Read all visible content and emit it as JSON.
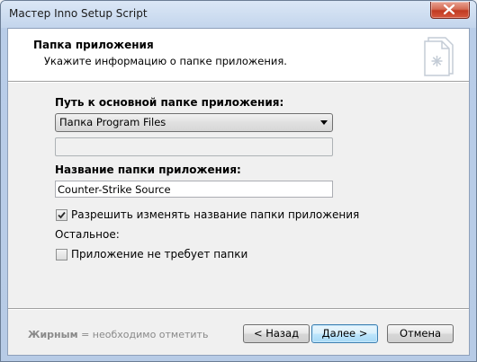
{
  "window": {
    "title": "Мастер Inno Setup Script"
  },
  "header": {
    "title": "Папка приложения",
    "subtitle": "Укажите информацию о папке приложения.",
    "icon": "wizard-document-icon"
  },
  "form": {
    "base_folder_label": "Путь к основной папке приложения:",
    "base_folder_value": "Папка Program Files",
    "custom_path_value": "",
    "app_folder_label": "Название папки приложения:",
    "app_folder_value": "Counter-Strike Source",
    "allow_change_label": "Разрешить изменять название папки приложения",
    "allow_change_checked": true,
    "other_label": "Остальное:",
    "no_folder_label": "Приложение не требует папки",
    "no_folder_checked": false
  },
  "footer": {
    "legend_bold": "Жирным",
    "legend_rest": " = необходимо отметить",
    "back_label": "< Назад",
    "next_label": "Далее >",
    "cancel_label": "Отмена"
  },
  "colors": {
    "default_button_border": "#3c7fb1",
    "titlebar": "#c3d5ec",
    "close_button": "#c13a22"
  }
}
